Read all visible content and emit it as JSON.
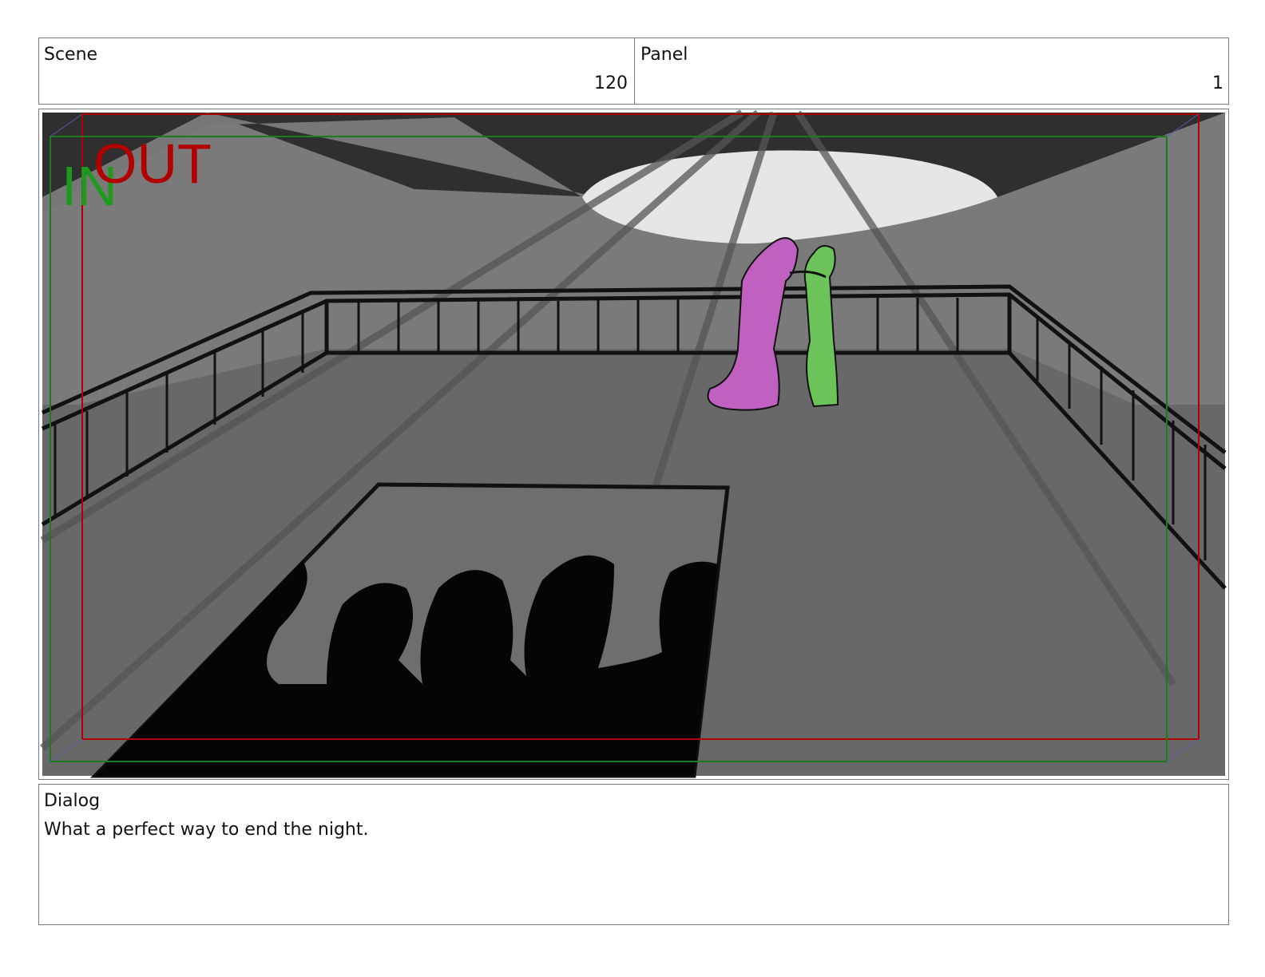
{
  "header": {
    "scene_label": "Scene",
    "scene_number": "120",
    "panel_label": "Panel",
    "panel_number": "1"
  },
  "frame": {
    "in_marker": "IN",
    "out_marker": "OUT",
    "colors": {
      "in_guide": "#1f7a1f",
      "out_guide": "#b00000",
      "woman_figure": "#c060c0",
      "man_figure": "#6cc35a"
    }
  },
  "dialog": {
    "label": "Dialog",
    "text": "What a perfect way to end the night."
  }
}
